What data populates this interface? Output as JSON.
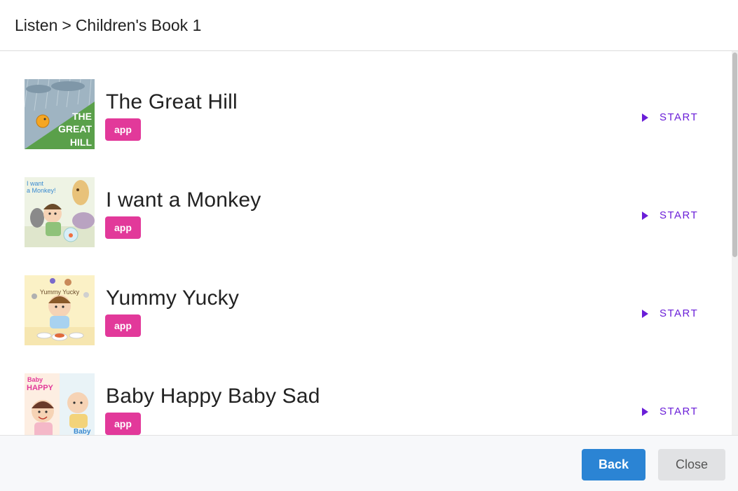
{
  "breadcrumb": {
    "section": "Listen",
    "separator": ">",
    "current": "Children's Book 1"
  },
  "books": [
    {
      "title": "The Great Hill",
      "badge": "app",
      "action": "START",
      "cover_icon": "great-hill-cover",
      "cover_text": [
        "THE",
        "GREAT",
        "HILL"
      ]
    },
    {
      "title": "I want a Monkey",
      "badge": "app",
      "action": "START",
      "cover_icon": "monkey-cover",
      "cover_text": [
        "I want",
        "a Monkey!"
      ]
    },
    {
      "title": "Yummy Yucky",
      "badge": "app",
      "action": "START",
      "cover_icon": "yummy-yucky-cover",
      "cover_text": [
        "Yummy Yucky"
      ]
    },
    {
      "title": "Baby Happy Baby Sad",
      "badge": "app",
      "action": "START",
      "cover_icon": "baby-happy-cover",
      "cover_text": [
        "Baby",
        "HAPPY",
        "Baby"
      ]
    }
  ],
  "footer": {
    "back_label": "Back",
    "close_label": "Close"
  },
  "colors": {
    "badge": "#e2399a",
    "start": "#6a1ed8",
    "back_button": "#2b84d4",
    "close_button": "#e1e2e4"
  }
}
